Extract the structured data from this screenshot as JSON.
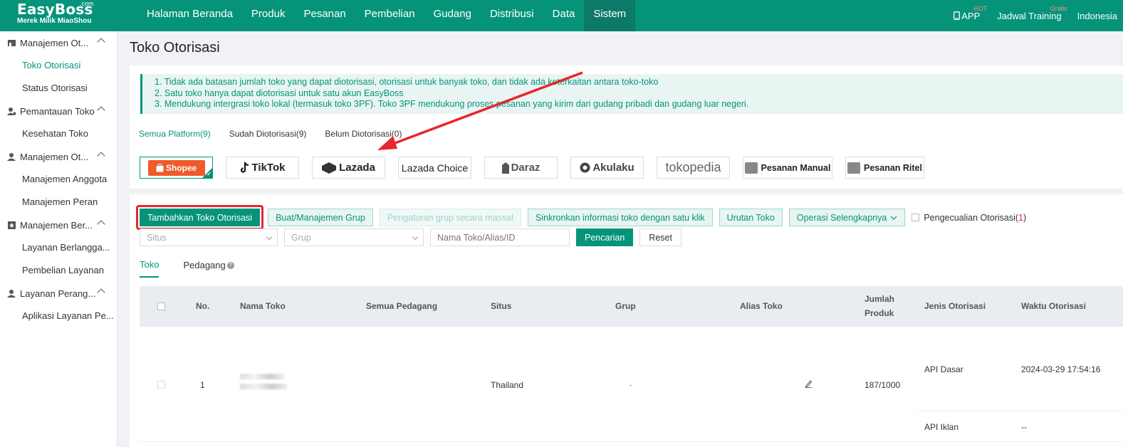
{
  "brand": {
    "name": "EasyBoss",
    "com": ".com",
    "tagline": "Merek Milik MiaoShou"
  },
  "topnav": {
    "items": [
      "Halaman Beranda",
      "Produk",
      "Pesanan",
      "Pembelian",
      "Gudang",
      "Distribusi",
      "Data",
      "Sistem"
    ],
    "active": "Sistem",
    "right": {
      "app": "APP",
      "app_badge": "HOT",
      "training": "Jadwal Training",
      "training_badge": "Gratis",
      "language": "Indonesia"
    }
  },
  "sidebar": {
    "groups": [
      {
        "label": "Manajemen Ot...",
        "items": [
          "Toko Otorisasi",
          "Status Otorisasi"
        ]
      },
      {
        "label": "Pemantauan Toko",
        "items": [
          "Kesehatan Toko"
        ]
      },
      {
        "label": "Manajemen Ot...",
        "items": [
          "Manajemen Anggota",
          "Manajemen Peran"
        ]
      },
      {
        "label": "Manajemen Ber...",
        "items": [
          "Layanan Berlangga...",
          "Pembelian Layanan"
        ]
      },
      {
        "label": "Layanan Perang...",
        "items": [
          "Aplikasi Layanan Pe..."
        ]
      }
    ],
    "active_item": "Toko Otorisasi"
  },
  "page": {
    "title": "Toko Otorisasi"
  },
  "notice": [
    "1. Tidak ada batasan jumlah toko yang dapat diotorisasi, otorisasi untuk banyak toko, dan tidak ada keterkaitan antara toko-toko",
    "2. Satu toko hanya dapat diotorisasi untuk satu akun EasyBoss",
    "3. Mendukung intergrasi toko lokal (termasuk toko 3PF). Toko 3PF mendukung proses pesanan yang kirim dari gudang pribadi dan gudang luar negeri."
  ],
  "platform_tabs": [
    "Semua Platform(9)",
    "Sudah Diotorisasi(9)",
    "Belum Diotorisasi(0)"
  ],
  "platforms": [
    "Shopee",
    "TikTok",
    "Lazada",
    "Lazada Choice",
    "Daraz",
    "Akulaku",
    "tokopedia",
    "Pesanan Manual",
    "Pesanan Ritel"
  ],
  "toolbar": {
    "add": "Tambahkan Toko Otorisasi",
    "group": "Buat/Manajemen Grup",
    "bulk_group": "Pengaturan grup secara massal",
    "sync": "Sinkronkan informasi toko dengan satu klik",
    "order": "Urutan Toko",
    "more": "Operasi Selengkapnya",
    "exclude": "Pengecualian Otorisasi(",
    "exclude_count": "1",
    "exclude_close": ")"
  },
  "filters": {
    "site": "Situs",
    "group": "Grup",
    "search_placeholder": "Nama Toko/Alias/ID",
    "search": "Pencarian",
    "reset": "Reset"
  },
  "list_tabs": [
    "Toko",
    "Pedagang"
  ],
  "table": {
    "headers": [
      "No.",
      "Nama Toko",
      "Semua Pedagang",
      "Situs",
      "Grup",
      "Alias Toko",
      "Jumlah",
      "Produk",
      "Jenis Otorisasi",
      "Waktu Otorisasi"
    ],
    "rows": [
      {
        "no": "1",
        "site": "Thailand",
        "group": ".",
        "products": "187/1000",
        "auth": [
          {
            "type": "API Dasar",
            "time": "2024-03-29 17:54:16"
          },
          {
            "type": "API Iklan",
            "time": "--"
          }
        ]
      }
    ]
  },
  "colors": {
    "brand": "#05937a",
    "highlight": "#e8262c"
  }
}
